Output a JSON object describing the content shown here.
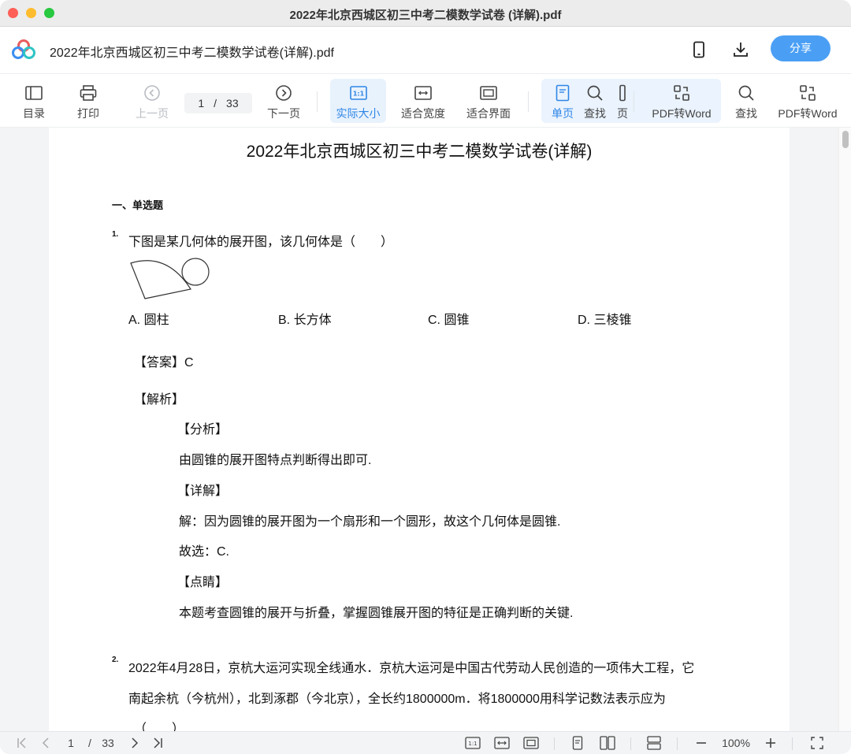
{
  "window": {
    "title": "2022年北京西城区初三中考二模数学试卷 (详解).pdf"
  },
  "header": {
    "doc_title": "2022年北京西城区初三中考二模数学试卷(详解).pdf",
    "share_label": "分享",
    "icons": [
      "phone-icon",
      "download-icon"
    ]
  },
  "toolbar": {
    "toc": "目录",
    "print": "打印",
    "prev": "上一页",
    "page_current": "1",
    "page_sep": "/",
    "page_total": "33",
    "next": "下一页",
    "actual_size": "实际大小",
    "fit_width": "适合宽度",
    "fit_window": "适合界面",
    "single_page": "单页",
    "find_inner": "查找",
    "page_inner": "页",
    "pdf_to_word_inner": "PDF转Word",
    "find": "查找",
    "pdf_to_word": "PDF转Word",
    "actual_size_badge": "1:1"
  },
  "document": {
    "title": "2022年北京西城区初三中考二模数学试卷(详解)",
    "section": "一、单选题",
    "q1": {
      "num": "1.",
      "text": "下图是某几何体的展开图，该几何体是（　　）",
      "options": [
        "A. 圆柱",
        "B. 长方体",
        "C. 圆锥",
        "D. 三棱锥"
      ],
      "answer": "【答案】C",
      "analysis_head": "【解析】",
      "fenxi_head": "【分析】",
      "fenxi": "由圆锥的展开图特点判断得出即可.",
      "detail_head": "【详解】",
      "detail": "解：因为圆锥的展开图为一个扇形和一个圆形，故这个几何体是圆锥.",
      "choose": "故选：C.",
      "dianjing_head": "【点睛】",
      "dianjing": "本题考查圆锥的展开与折叠，掌握圆锥展开图的特征是正确判断的关键."
    },
    "q2": {
      "num": "2.",
      "line1": "2022年4月28日，京杭大运河实现全线通水．京杭大运河是中国古代劳动人民创造的一项伟大工程，它",
      "line2": "南起余杭（今杭州），北到涿郡（今北京），全长约1800000m．将1800000用科学记数法表示应为",
      "line3": "（　　）"
    }
  },
  "statusbar": {
    "page_current": "1",
    "page_sep": "/",
    "page_total": "33",
    "zoom": "100%",
    "actual_badge": "1:1"
  },
  "colors": {
    "accent": "#2f86e6",
    "share": "#4a9ff5"
  }
}
